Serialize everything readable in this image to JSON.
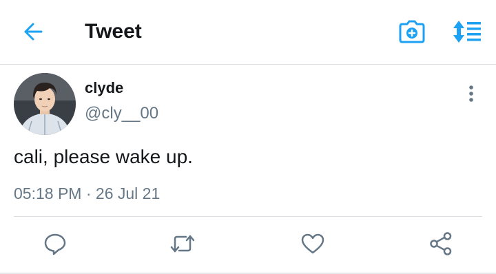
{
  "header": {
    "title": "Tweet",
    "back_icon": "arrow-left-icon",
    "camera_icon": "camera-plus-icon",
    "sort_icon": "sort-list-icon"
  },
  "tweet": {
    "author_name": "clyde",
    "author_handle": "@cly__00",
    "text": "cali, please wake up.",
    "time": "05:18 PM",
    "separator": "·",
    "date": "26 Jul 21"
  },
  "actions": {
    "reply_icon": "reply-bubble-icon",
    "retweet_icon": "retweet-icon",
    "like_icon": "heart-icon",
    "share_icon": "share-icon",
    "more_icon": "more-vertical-icon"
  },
  "colors": {
    "accent": "#1da1f2",
    "text_primary": "#14171a",
    "text_secondary": "#657786",
    "divider": "#dcdfe3",
    "action_icon": "#657786"
  }
}
